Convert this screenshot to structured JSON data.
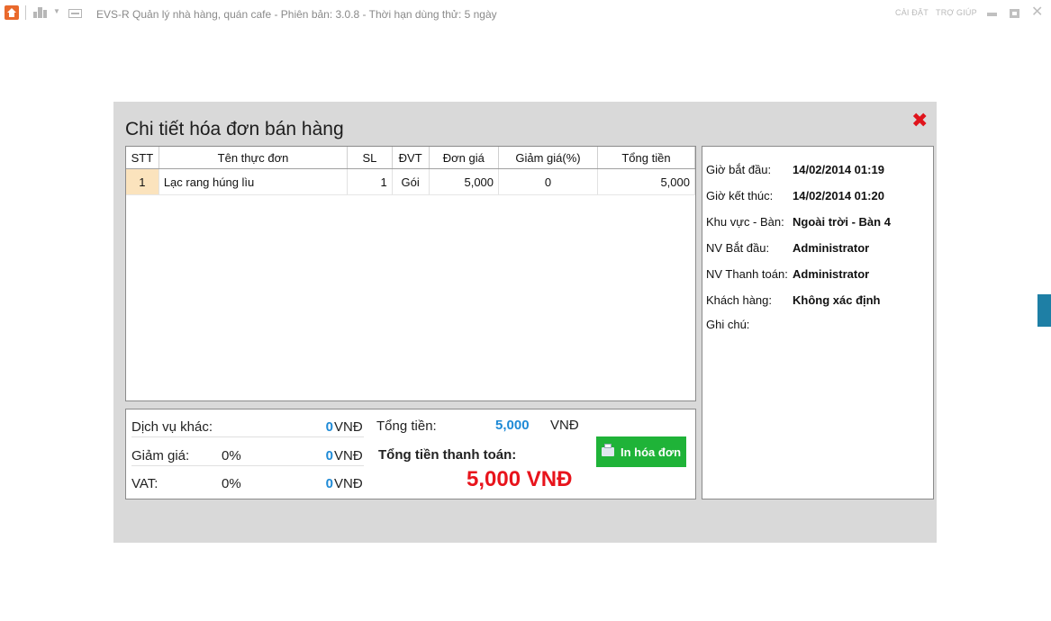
{
  "app": {
    "title": "EVS-R Quản lý nhà hàng, quán cafe - Phiên bản: 3.0.8 - Thời hạn dùng thử: 5 ngày",
    "menu_settings": "CÀI ĐẶT",
    "menu_help": "TRỢ GIÚP"
  },
  "dialog": {
    "title": "Chi tiết hóa đơn bán hàng",
    "close_icon": "close-icon",
    "colors": {
      "close": "#e0141c",
      "accent_blue": "#1e8ad6",
      "total_red": "#e8141c",
      "print_button": "#1fb338",
      "row_highlight": "#fbe3bd"
    }
  },
  "grid": {
    "columns": [
      "STT",
      "Tên thực đơn",
      "SL",
      "ĐVT",
      "Đơn giá",
      "Giảm giá(%)",
      "Tổng tiền"
    ],
    "rows": [
      {
        "stt": "1",
        "name": "Lạc rang húng lìu",
        "sl": "1",
        "dvt": "Gói",
        "price": "5,000",
        "discount": "0",
        "total": "5,000"
      }
    ]
  },
  "summary": {
    "other_services": {
      "label": "Dịch vụ khác:",
      "value": "0",
      "unit": "VNĐ"
    },
    "discount": {
      "label": "Giảm giá:",
      "percent": "0%",
      "value": "0",
      "unit": "VNĐ"
    },
    "vat": {
      "label": "VAT:",
      "percent": "0%",
      "value": "0",
      "unit": "VNĐ"
    },
    "total": {
      "label": "Tổng tiền:",
      "value": "5,000",
      "unit": "VNĐ"
    },
    "grand_total": {
      "label": "Tổng tiền thanh toán:",
      "value": "5,000 VNĐ"
    },
    "print_button": "In hóa đơn"
  },
  "info": {
    "start_time": {
      "label": "Giờ bắt đầu:",
      "value": "14/02/2014 01:19"
    },
    "end_time": {
      "label": "Giờ kết thúc:",
      "value": "14/02/2014 01:20"
    },
    "area_table": {
      "label": "Khu vực - Bàn:",
      "value": "Ngoài trời - Bàn 4"
    },
    "staff_start": {
      "label": "NV Bắt đầu:",
      "value": "Administrator"
    },
    "staff_payment": {
      "label": "NV Thanh toán:",
      "value": "Administrator"
    },
    "customer": {
      "label": "Khách hàng:",
      "value": "Không xác định"
    },
    "note": {
      "label": "Ghi chú:",
      "value": ""
    }
  }
}
